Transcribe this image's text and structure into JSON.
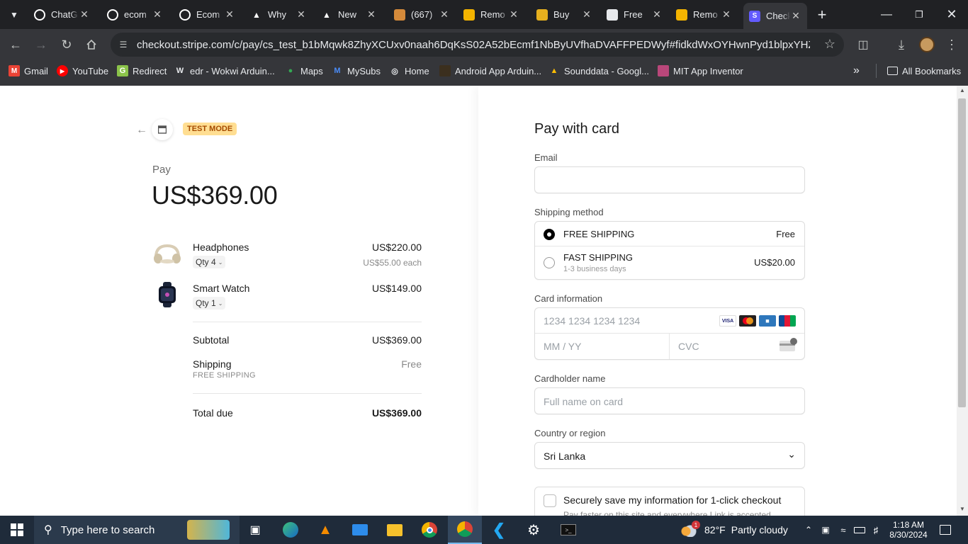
{
  "tabs": [
    {
      "title": "ChatGPT",
      "icon": "openai-icon",
      "color": "#ffffff"
    },
    {
      "title": "ecom",
      "icon": "github-icon",
      "color": "#ffffff"
    },
    {
      "title": "Ecom",
      "icon": "github-icon",
      "color": "#ffffff"
    },
    {
      "title": "Why",
      "icon": "vercel-icon",
      "color": "#ffffff"
    },
    {
      "title": "New",
      "icon": "vercel-icon",
      "color": "#ffffff"
    },
    {
      "title": "(667)",
      "icon": "hand-icon",
      "color": "#d58a3a"
    },
    {
      "title": "Remo",
      "icon": "slides-icon",
      "color": "#f4b400"
    },
    {
      "title": "Buy",
      "icon": "envato-icon",
      "color": "#e6b01e"
    },
    {
      "title": "Free",
      "icon": "mountain-icon",
      "color": "#e8eaed"
    },
    {
      "title": "Remo",
      "icon": "slides-icon",
      "color": "#f4b400"
    },
    {
      "title": "Check",
      "icon": "stripe-icon",
      "color": "#635bff"
    }
  ],
  "url": "checkout.stripe.com/c/pay/cs_test_b1bMqwk8ZhyXCUxv0naah6DqKsS02A52bEcmf1NbByUVfhaDVAFFPEDWyf#fidkdWxOYHwnPyd1blpxYHZxWjA0VXE2P...",
  "bookmarks": [
    {
      "label": "Gmail",
      "icon": "gmail-icon"
    },
    {
      "label": "YouTube",
      "icon": "youtube-icon"
    },
    {
      "label": "Redirect",
      "icon": "redirect-icon"
    },
    {
      "label": "edr - Wokwi Arduin...",
      "icon": "wokwi-icon"
    },
    {
      "label": "Maps",
      "icon": "maps-icon"
    },
    {
      "label": "MySubs",
      "icon": "mysubs-icon"
    },
    {
      "label": "Home",
      "icon": "globe-icon"
    },
    {
      "label": "Android App Arduin...",
      "icon": "android-icon"
    },
    {
      "label": "Sounddata - Googl...",
      "icon": "drive-icon"
    },
    {
      "label": "MIT App Inventor",
      "icon": "mit-icon"
    }
  ],
  "all_bookmarks": "All Bookmarks",
  "summary": {
    "test_mode": "TEST MODE",
    "pay_label": "Pay",
    "amount": "US$369.00",
    "items": [
      {
        "name": "Headphones",
        "qty": "Qty 4",
        "price": "US$220.00",
        "each": "US$55.00 each"
      },
      {
        "name": "Smart Watch",
        "qty": "Qty 1",
        "price": "US$149.00",
        "each": ""
      }
    ],
    "subtotal_label": "Subtotal",
    "subtotal_value": "US$369.00",
    "shipping_label": "Shipping",
    "shipping_sub": "FREE SHIPPING",
    "shipping_value": "Free",
    "total_label": "Total due",
    "total_value": "US$369.00"
  },
  "form": {
    "heading": "Pay with card",
    "email_label": "Email",
    "email_value": "",
    "shipping_method_label": "Shipping method",
    "shipping_options": [
      {
        "name": "FREE SHIPPING",
        "sub": "",
        "price": "Free",
        "selected": true
      },
      {
        "name": "FAST SHIPPING",
        "sub": "1-3 business days",
        "price": "US$20.00",
        "selected": false
      }
    ],
    "card_label": "Card information",
    "card_number_placeholder": "1234 1234 1234 1234",
    "expiry_placeholder": "MM / YY",
    "cvc_placeholder": "CVC",
    "card_brands": [
      "VISA",
      "Mastercard",
      "Amex",
      "JCB"
    ],
    "cardholder_label": "Cardholder name",
    "cardholder_placeholder": "Full name on card",
    "country_label": "Country or region",
    "country_value": "Sri Lanka",
    "save_info_label": "Securely save my information for 1-click checkout",
    "save_info_sub": "Pay faster on this site and everywhere Link is accepted."
  },
  "taskbar": {
    "search_placeholder": "Type here to search",
    "weather_temp": "82°F",
    "weather_desc": "Partly cloudy",
    "weather_badge": "1",
    "time": "1:18 AM",
    "date": "8/30/2024"
  }
}
